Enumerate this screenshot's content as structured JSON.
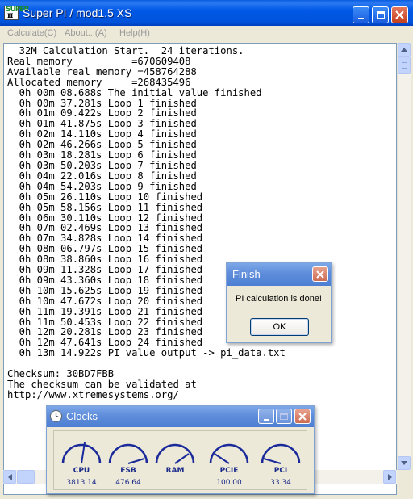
{
  "window": {
    "title": "Super PI / mod1.5 XS",
    "icon": "super-pi-app-icon",
    "icon_text": "SUPER"
  },
  "menu": [
    "Calculate(C)",
    "About...(A)",
    "Help(H)"
  ],
  "log_lines": [
    "  32M Calculation Start.  24 iterations.",
    "Real memory          =670609408",
    "Available real memory =458764288",
    "Allocated memory     =268435496",
    "  0h 00m 08.688s The initial value finished",
    "  0h 00m 37.281s Loop 1 finished",
    "  0h 01m 09.422s Loop 2 finished",
    "  0h 01m 41.875s Loop 3 finished",
    "  0h 02m 14.110s Loop 4 finished",
    "  0h 02m 46.266s Loop 5 finished",
    "  0h 03m 18.281s Loop 6 finished",
    "  0h 03m 50.203s Loop 7 finished",
    "  0h 04m 22.016s Loop 8 finished",
    "  0h 04m 54.203s Loop 9 finished",
    "  0h 05m 26.110s Loop 10 finished",
    "  0h 05m 58.156s Loop 11 finished",
    "  0h 06m 30.110s Loop 12 finished",
    "  0h 07m 02.469s Loop 13 finished",
    "  0h 07m 34.828s Loop 14 finished",
    "  0h 08m 06.797s Loop 15 finished",
    "  0h 08m 38.860s Loop 16 finished",
    "  0h 09m 11.328s Loop 17 finished",
    "  0h 09m 43.360s Loop 18 finished",
    "  0h 10m 15.625s Loop 19 finished",
    "  0h 10m 47.672s Loop 20 finished",
    "  0h 11m 19.391s Loop 21 finished",
    "  0h 11m 50.453s Loop 22 finished",
    "  0h 12m 20.281s Loop 23 finished",
    "  0h 12m 47.641s Loop 24 finished",
    "  0h 13m 14.922s PI value output -> pi_data.txt",
    "",
    "Checksum: 30BD7FBB",
    "The checksum can be validated at",
    "http://www.xtremesystems.org/"
  ],
  "finish_dialog": {
    "title": "Finish",
    "message": "PI calculation is done!",
    "ok_label": "OK"
  },
  "clocks": {
    "title": "Clocks",
    "gauges": [
      {
        "label": "CPU",
        "value": "3813.14"
      },
      {
        "label": "FSB",
        "value": "476.64"
      },
      {
        "label": "RAM",
        "value": ""
      },
      {
        "label": "PCIE",
        "value": "100.00"
      },
      {
        "label": "PCI",
        "value": "33.34"
      }
    ]
  },
  "colors": {
    "titlebar": "#0054E3",
    "inactive_titlebar": "#7DA7E8",
    "gauge_arc": "#1a2a9a",
    "gauge_text": "#1a2a8a",
    "window_bg": "#ECE9D8"
  }
}
